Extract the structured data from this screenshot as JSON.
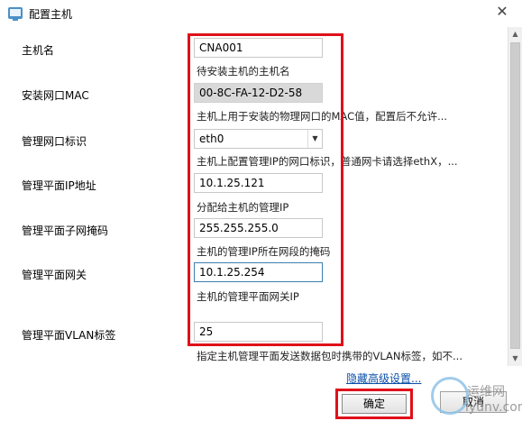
{
  "window": {
    "title": "配置主机",
    "close_glyph": "✕"
  },
  "form": {
    "hostname": {
      "label": "主机名",
      "value": "CNA001",
      "hint": "待安装主机的主机名"
    },
    "mac": {
      "label": "安装网口MAC",
      "value": "00-8C-FA-12-D2-58",
      "hint": "主机上用于安装的物理网口的MAC值，配置后不允许..."
    },
    "mgmt_nic": {
      "label": "管理网口标识",
      "value": "eth0",
      "hint": "主机上配置管理IP的网口标识，普通网卡请选择ethX，..."
    },
    "mgmt_ip": {
      "label": "管理平面IP地址",
      "value": "10.1.25.121",
      "hint": "分配给主机的管理IP"
    },
    "mgmt_mask": {
      "label": "管理平面子网掩码",
      "value": "255.255.255.0",
      "hint": "主机的管理IP所在网段的掩码"
    },
    "mgmt_gw": {
      "label": "管理平面网关",
      "value": "10.1.25.254",
      "hint": "主机的管理平面网关IP"
    },
    "vlan": {
      "label": "管理平面VLAN标签",
      "value": "25",
      "hint": "指定主机管理平面发送数据包时携带的VLAN标签，如不..."
    }
  },
  "footer": {
    "advanced_link": "隐藏高级设置...",
    "ok_label": "确定",
    "cancel_label": "取消"
  },
  "watermark": {
    "line1": "运维网",
    "line2": "iyunv.com"
  },
  "colors": {
    "highlight_red": "#e0101a",
    "link_blue": "#0b4fa8",
    "readonly_bg": "#d9d9d9"
  }
}
